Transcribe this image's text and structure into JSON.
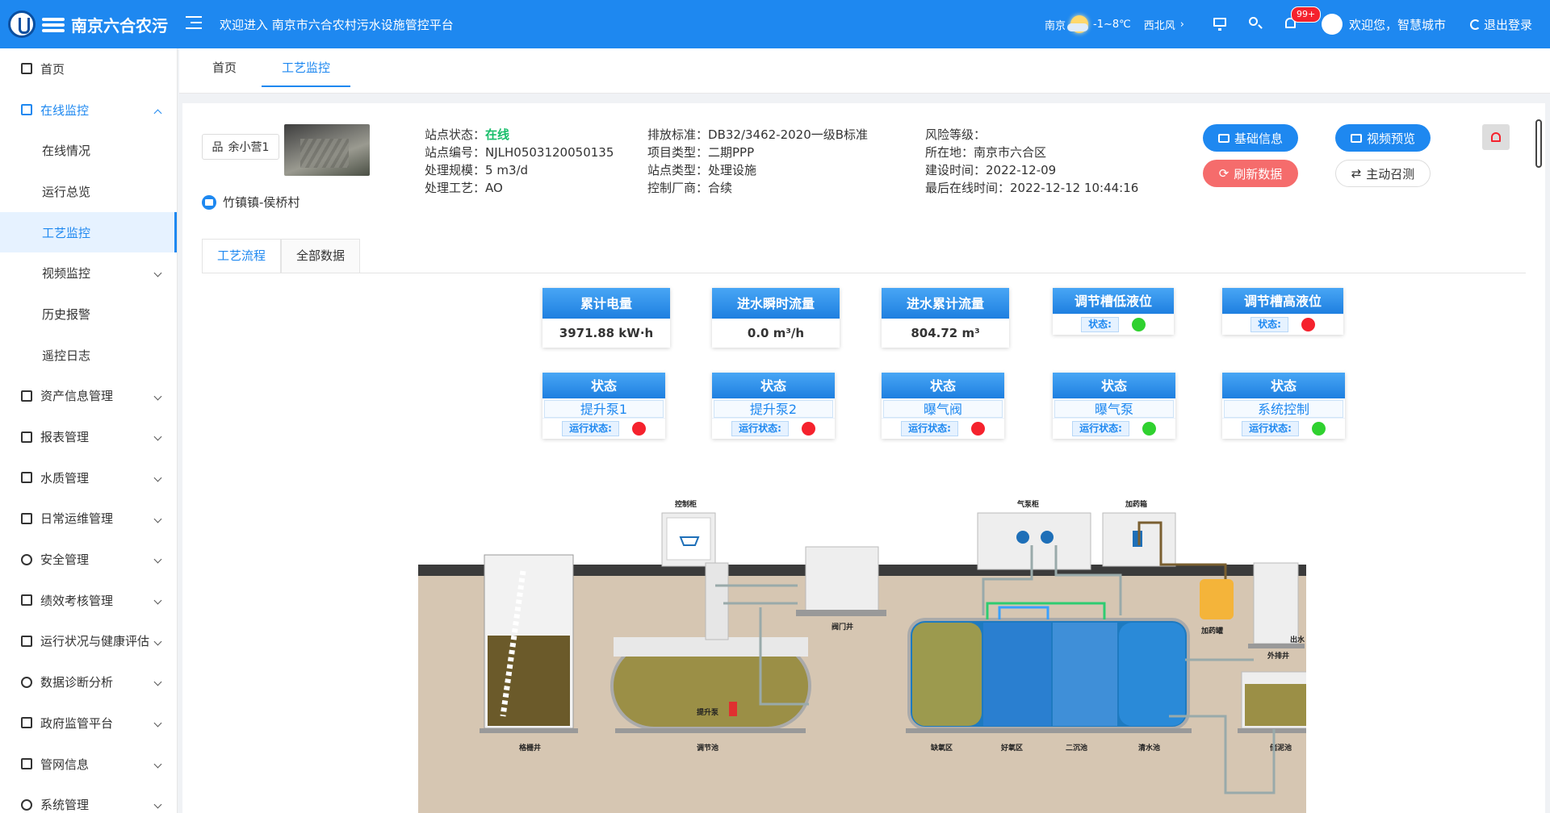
{
  "header": {
    "logo_text": "南京六合农污",
    "welcome": "欢迎进入 南京市六合农村污水设施管控平台",
    "weather": {
      "city": "南京",
      "temp": "-1~8℃",
      "wind": "西北风"
    },
    "notification_count": "99+",
    "user": "欢迎您，智慧城市",
    "logout": "退出登录"
  },
  "sidebar": {
    "items": [
      {
        "label": "首页",
        "icon": "home-icon"
      },
      {
        "label": "在线监控",
        "icon": "chart-line-icon",
        "open": true
      },
      {
        "label": "在线情况"
      },
      {
        "label": "运行总览"
      },
      {
        "label": "工艺监控",
        "active": true
      },
      {
        "label": "视频监控"
      },
      {
        "label": "历史报警"
      },
      {
        "label": "遥控日志"
      },
      {
        "label": "资产信息管理",
        "icon": "org-icon"
      },
      {
        "label": "报表管理",
        "icon": "bar-chart-icon"
      },
      {
        "label": "水质管理",
        "icon": "flask-icon"
      },
      {
        "label": "日常运维管理",
        "icon": "calendar-icon"
      },
      {
        "label": "安全管理",
        "icon": "compass-icon"
      },
      {
        "label": "绩效考核管理",
        "icon": "user-check-icon"
      },
      {
        "label": "运行状况与健康评估",
        "icon": "grid-icon"
      },
      {
        "label": "数据诊断分析",
        "icon": "pie-icon"
      },
      {
        "label": "政府监管平台",
        "icon": "share-icon"
      },
      {
        "label": "管网信息",
        "icon": "list-icon"
      },
      {
        "label": "系统管理",
        "icon": "gear-icon"
      }
    ]
  },
  "tabs": [
    "首页",
    "工艺监控"
  ],
  "site": {
    "name": "余小营1",
    "village": "竹镇镇-侯桥村",
    "info_col1": [
      {
        "k": "站点状态：",
        "v": "在线"
      },
      {
        "k": "站点编号：",
        "v": "NJLH0503120050135"
      },
      {
        "k": "处理规模：",
        "v": "5 m3/d"
      },
      {
        "k": "处理工艺：",
        "v": "AO"
      }
    ],
    "info_col2": [
      {
        "k": "排放标准：",
        "v": "DB32/3462-2020一级B标准"
      },
      {
        "k": "项目类型：",
        "v": "二期PPP"
      },
      {
        "k": "站点类型：",
        "v": "处理设施"
      },
      {
        "k": "控制厂商：",
        "v": "合续"
      }
    ],
    "info_col3": [
      {
        "k": "风险等级：",
        "v": ""
      },
      {
        "k": "所在地：",
        "v": "南京市六合区"
      },
      {
        "k": "建设时间：",
        "v": "2022-12-09"
      },
      {
        "k": "最后在线时间：",
        "v": "2022-12-12 10:44:16"
      }
    ]
  },
  "buttons": {
    "basic_info": "基础信息",
    "video_preview": "视频预览",
    "refresh": "刷新数据",
    "active_call": "主动召测"
  },
  "subtabs": [
    "工艺流程",
    "全部数据"
  ],
  "metrics": [
    {
      "title": "累计电量",
      "value": "3971.88 kW·h"
    },
    {
      "title": "进水瞬时流量",
      "value": "0.0 m³/h"
    },
    {
      "title": "进水累计流量",
      "value": "804.72 m³"
    }
  ],
  "levels": [
    {
      "title": "调节槽低液位",
      "tag": "状态:",
      "status": "green"
    },
    {
      "title": "调节槽高液位",
      "tag": "状态:",
      "status": "red"
    }
  ],
  "devices": [
    {
      "title": "状态",
      "name": "提升泵1",
      "tag": "运行状态:",
      "status": "red"
    },
    {
      "title": "状态",
      "name": "提升泵2",
      "tag": "运行状态:",
      "status": "red"
    },
    {
      "title": "状态",
      "name": "曝气阀",
      "tag": "运行状态:",
      "status": "red"
    },
    {
      "title": "状态",
      "name": "曝气泵",
      "tag": "运行状态:",
      "status": "green"
    },
    {
      "title": "状态",
      "name": "系统控制",
      "tag": "运行状态:",
      "status": "green"
    }
  ],
  "diagram_labels": {
    "control_cabinet": "控制柜",
    "air_pump_cabinet": "气泵柜",
    "dosing_box": "加药箱",
    "valve_well": "阀门井",
    "dosing_tank": "加药罐",
    "outlet": "出水",
    "outer_drain_well": "外排井",
    "lift_pump": "提升泵",
    "screen_well": "格栅井",
    "regulating_tank": "调节池",
    "anoxic_zone": "缺氧区",
    "aerobic_zone": "好氧区",
    "secondary_clarifier": "二沉池",
    "clear_water_tank": "清水池",
    "sludge_tank": "储泥池"
  },
  "colors": {
    "primary": "#1e88f0",
    "online": "#19be6b",
    "danger": "#f5222d",
    "ok": "#2fd12f"
  }
}
